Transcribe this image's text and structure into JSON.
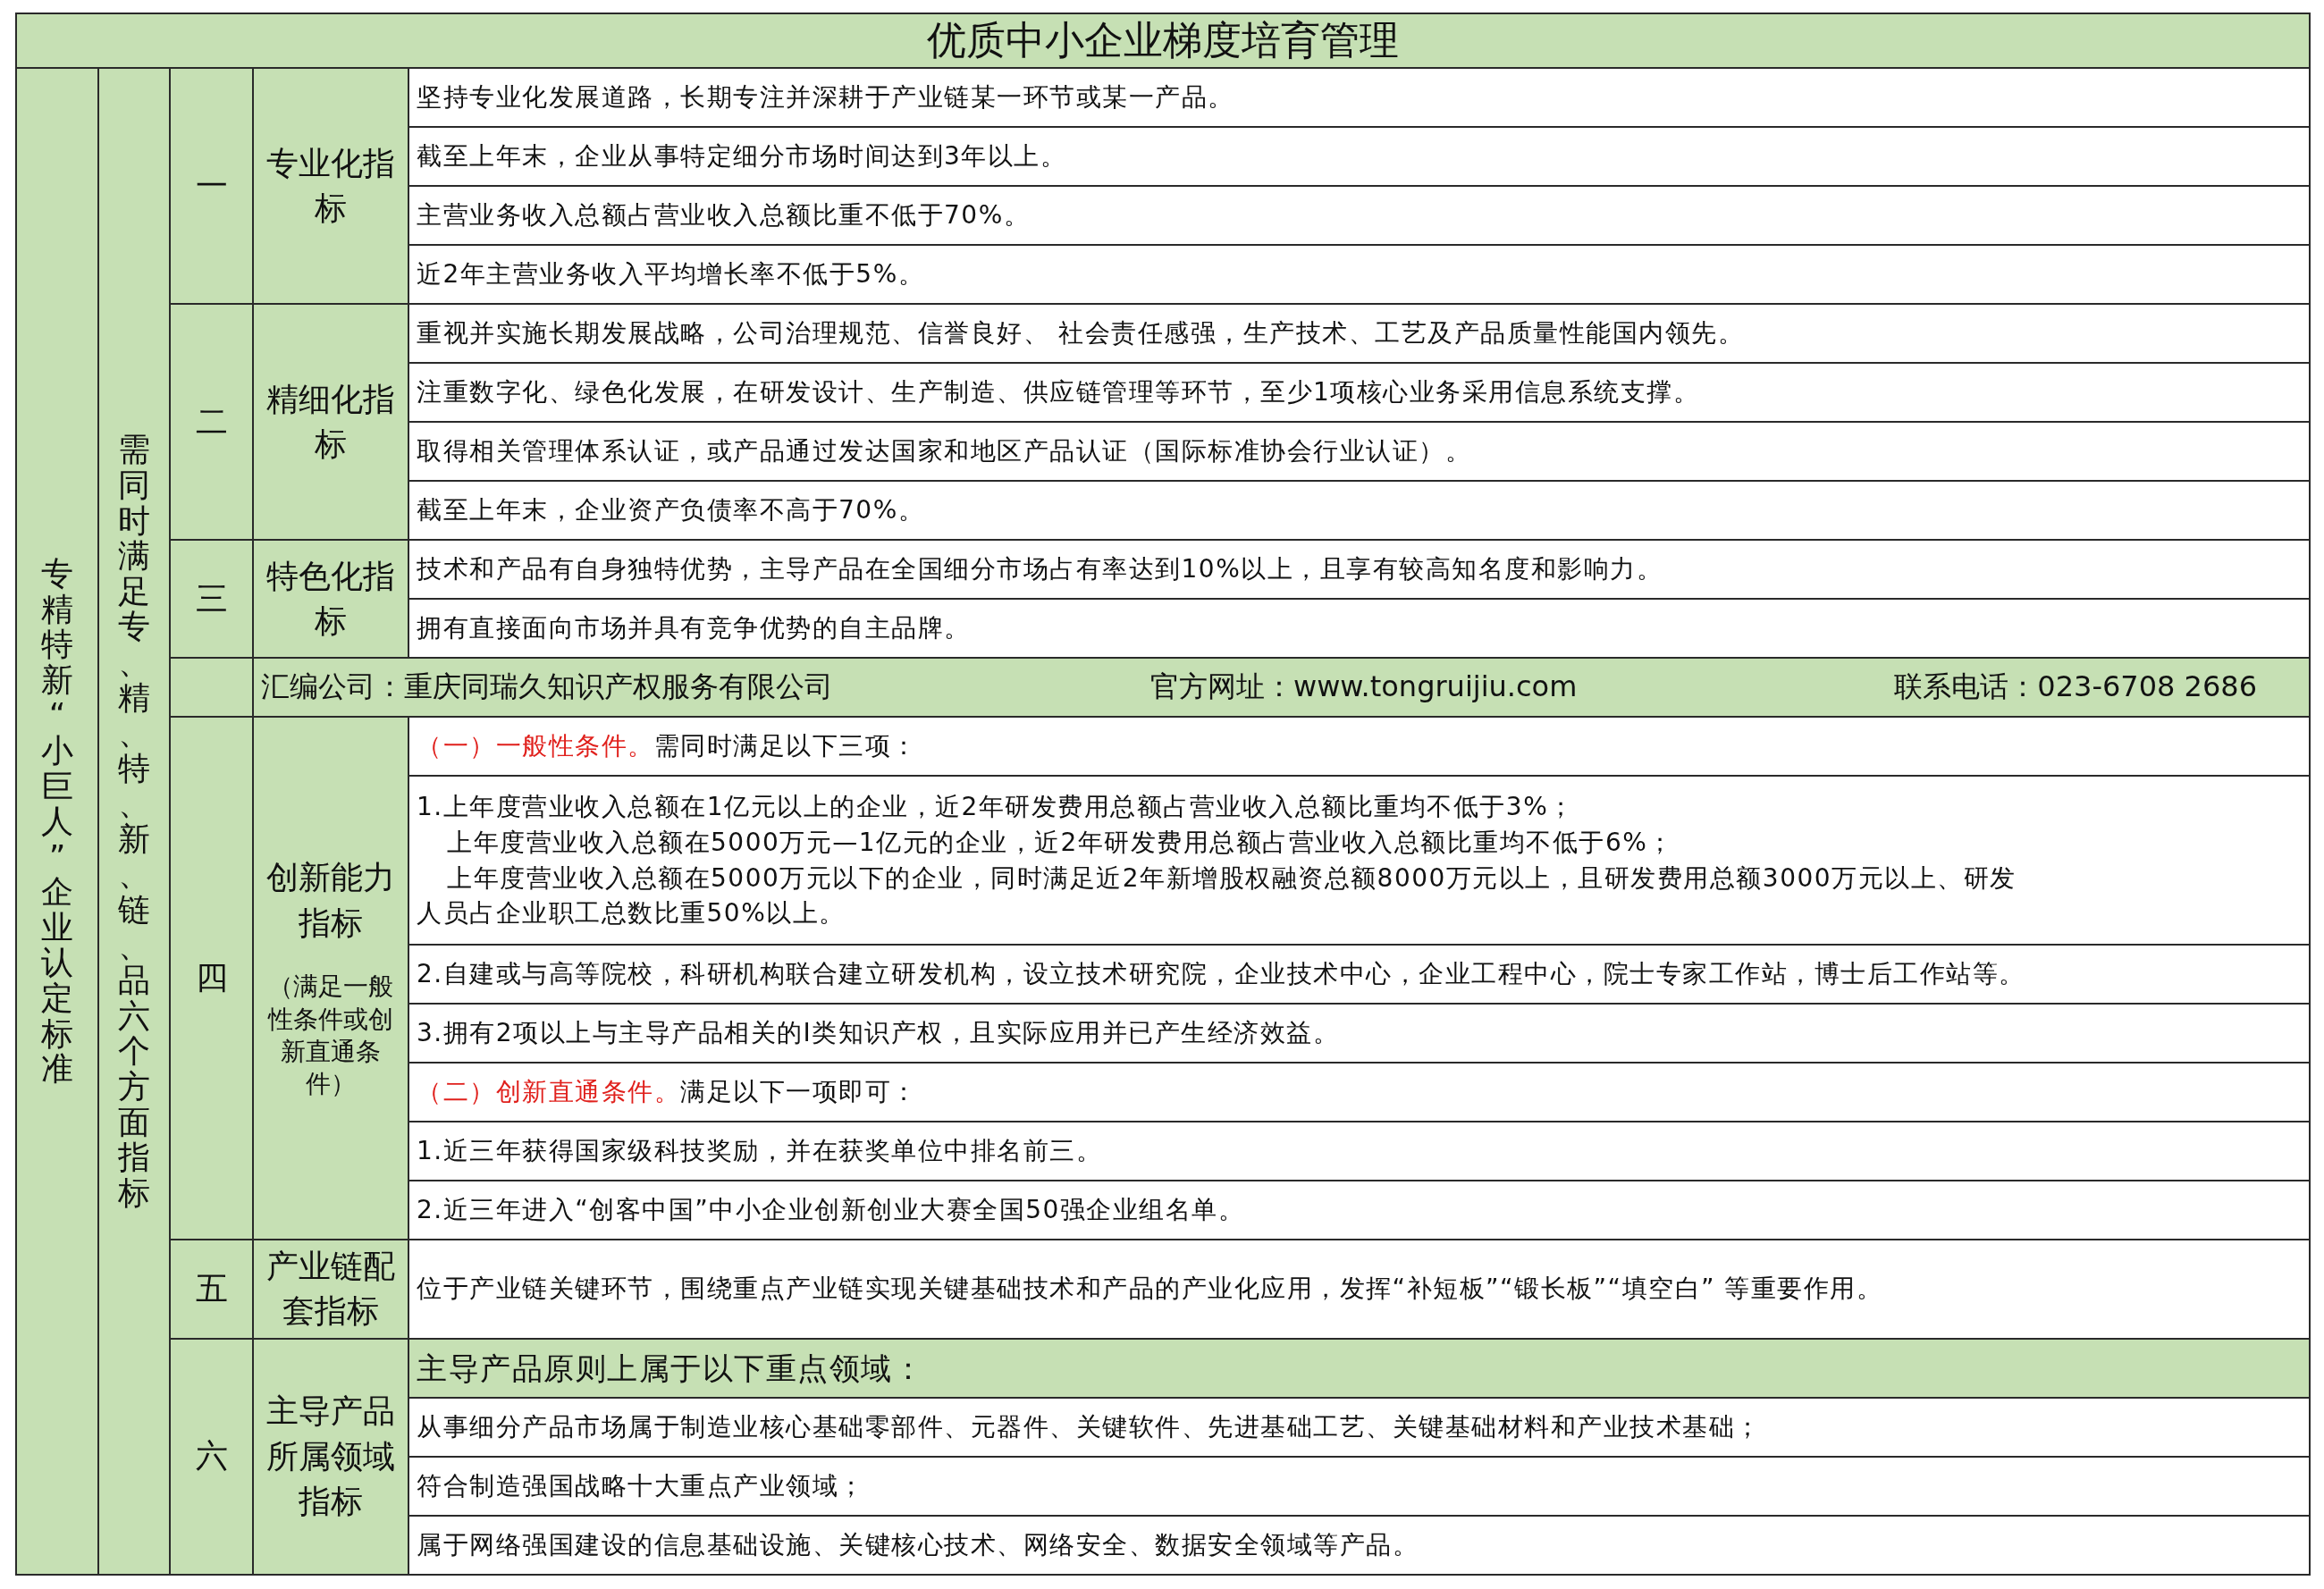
{
  "title": "优质中小企业梯度培育管理",
  "side_label": "专精特新“小巨人”企业认定标准",
  "scope_label": "需同时满足专、精、特、新、链、品六个方面指标",
  "groups": [
    {
      "kind": "section",
      "number": "一",
      "name": "专业化指标",
      "items": [
        {
          "kind": "text",
          "text": "坚持专业化发展道路，长期专注并深耕于产业链某一环节或某一产品。"
        },
        {
          "kind": "text",
          "text": "截至上年末，企业从事特定细分市场时间达到3年以上。"
        },
        {
          "kind": "text",
          "text": "主营业务收入总额占营业收入总额比重不低于70%。"
        },
        {
          "kind": "text",
          "text": "近2年主营业务收入平均增长率不低于5%。"
        }
      ]
    },
    {
      "kind": "section",
      "number": "二",
      "name": "精细化指标",
      "items": [
        {
          "kind": "text",
          "text": "重视并实施长期发展战略，公司治理规范、信誉良好、 社会责任感强，生产技术、工艺及产品质量性能国内领先。"
        },
        {
          "kind": "text",
          "text": "注重数字化、绿色化发展，在研发设计、生产制造、供应链管理等环节，至少1项核心业务采用信息系统支撑。"
        },
        {
          "kind": "text",
          "text": "取得相关管理体系认证，或产品通过发达国家和地区产品认证（国际标准协会行业认证）。"
        },
        {
          "kind": "text",
          "text": "截至上年末，企业资产负债率不高于70%。"
        }
      ]
    },
    {
      "kind": "section",
      "number": "三",
      "name": "特色化指标",
      "items": [
        {
          "kind": "text",
          "text": "技术和产品有自身独特优势，主导产品在全国细分市场占有率达到10%以上，且享有较高知名度和影响力。"
        },
        {
          "kind": "text",
          "text": "拥有直接面向市场并具有竞争优势的自主品牌。"
        }
      ]
    },
    {
      "kind": "info",
      "company": "汇编公司：重庆同瑞久知识产权服务有限公司",
      "website": "官方网址：www.tongruijiu.com",
      "phone": "联系电话：023-6708 2686"
    },
    {
      "kind": "section",
      "number": "四",
      "name": "创新能力指标",
      "note": "（满足一般性条件或创新直通条件）",
      "items": [
        {
          "kind": "condition",
          "label": "（一）一般性条件。",
          "text": "需同时满足以下三项："
        },
        {
          "kind": "multiline",
          "lines": [
            {
              "text": "1.上年度营业收入总额在1亿元以上的企业，近2年研发费用总额占营业收入总额比重均不低于3%；",
              "indented": false
            },
            {
              "text": "上年度营业收入总额在5000万元—1亿元的企业，近2年研发费用总额占营业收入总额比重均不低于6%；",
              "indented": true
            },
            {
              "text": "上年度营业收入总额在5000万元以下的企业，同时满足近2年新增股权融资总额8000万元以上，且研发费用总额3000万元以上、研发",
              "indented": true
            },
            {
              "text": "人员占企业职工总数比重50%以上。",
              "indented": false
            }
          ]
        },
        {
          "kind": "text",
          "text": "2.自建或与高等院校，科研机构联合建立研发机构，设立技术研究院，企业技术中心，企业工程中心，院士专家工作站，博士后工作站等。"
        },
        {
          "kind": "text",
          "text": "3.拥有2项以上与主导产品相关的Ⅰ类知识产权，且实际应用并已产生经济效益。"
        },
        {
          "kind": "condition",
          "label": "（二）创新直通条件。",
          "text": "满足以下一项即可："
        },
        {
          "kind": "text",
          "text": "1.近三年获得国家级科技奖励，并在获奖单位中排名前三。"
        },
        {
          "kind": "text",
          "text": "2.近三年进入“创客中国”中小企业创新创业大赛全国50强企业组名单。"
        }
      ]
    },
    {
      "kind": "section",
      "number": "五",
      "name": "产业链配套指标",
      "items": [
        {
          "kind": "text",
          "text": "位于产业链关键环节，围绕重点产业链实现关键基础技术和产品的产业化应用，发挥“补短板”“锻长板”“填空白” 等重要作用。"
        }
      ]
    },
    {
      "kind": "section",
      "number": "六",
      "name": "主导产品所属领域指标",
      "items": [
        {
          "kind": "heading",
          "text": "主导产品原则上属于以下重点领域："
        },
        {
          "kind": "text",
          "text": "从事细分产品市场属于制造业核心基础零部件、元器件、关键软件、先进基础工艺、关键基础材料和产业技术基础；"
        },
        {
          "kind": "text",
          "text": "符合制造强国战略十大重点产业领域；"
        },
        {
          "kind": "text",
          "text": "属于网络强国建设的信息基础设施、关键核心技术、网络安全、数据安全领域等产品。"
        }
      ]
    }
  ]
}
